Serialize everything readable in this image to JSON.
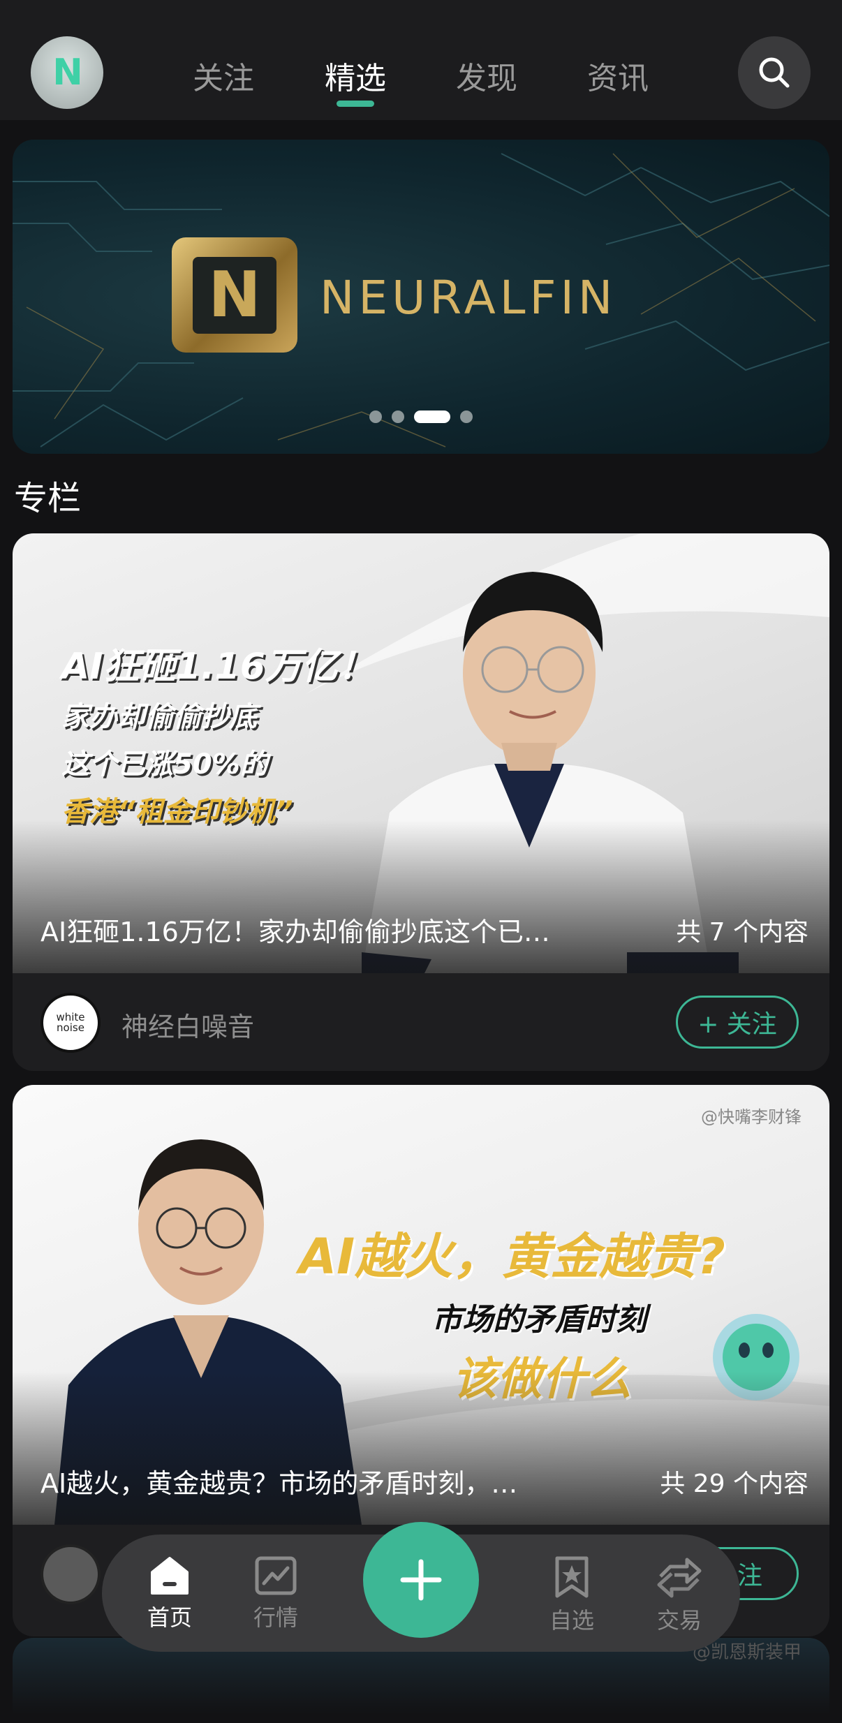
{
  "topbar": {
    "avatar_text": "N",
    "tabs": [
      {
        "label": "关注"
      },
      {
        "label": "精选"
      },
      {
        "label": "发现"
      },
      {
        "label": "资讯"
      }
    ],
    "active_tab": "精选",
    "search_icon": "search-icon"
  },
  "banner": {
    "brand": "NEURALFIN",
    "logo_letter": "N",
    "carousel_total": 4,
    "carousel_active": 3
  },
  "section": {
    "title": "专栏"
  },
  "cards": [
    {
      "overlay_lines": [
        "AI狂砸1.16万亿！",
        "家办却偷偷抄底",
        "这个已涨50%的",
        "香港“租金印钞机”"
      ],
      "title": "AI狂砸1.16万亿！家办却偷偷抄底这个已…",
      "count": "共 7 个内容",
      "author": "神经白噪音",
      "author_avatar_text": "white noise",
      "follow_label": "+ 关注"
    },
    {
      "watermark": "@快嘴李财锋",
      "overlay_lines": [
        "AI越火，黄金越贵?",
        "市场的矛盾时刻",
        "该做什么"
      ],
      "title": "AI越火，黄金越贵？市场的矛盾时刻，…",
      "count": "共 29 个内容",
      "follow_label": "关注"
    }
  ],
  "peek": {
    "watermark": "@凯恩斯装甲"
  },
  "bottom_nav": {
    "items": [
      {
        "label": "首页",
        "icon": "home-icon"
      },
      {
        "label": "行情",
        "icon": "chart-icon"
      },
      {
        "label": "自选",
        "icon": "bookmark-star-icon"
      },
      {
        "label": "交易",
        "icon": "swap-icon"
      }
    ],
    "active": "首页",
    "plus_icon": "plus-icon"
  },
  "colors": {
    "accent": "#3db795",
    "background": "#121214",
    "gold": "#e8b93a"
  }
}
